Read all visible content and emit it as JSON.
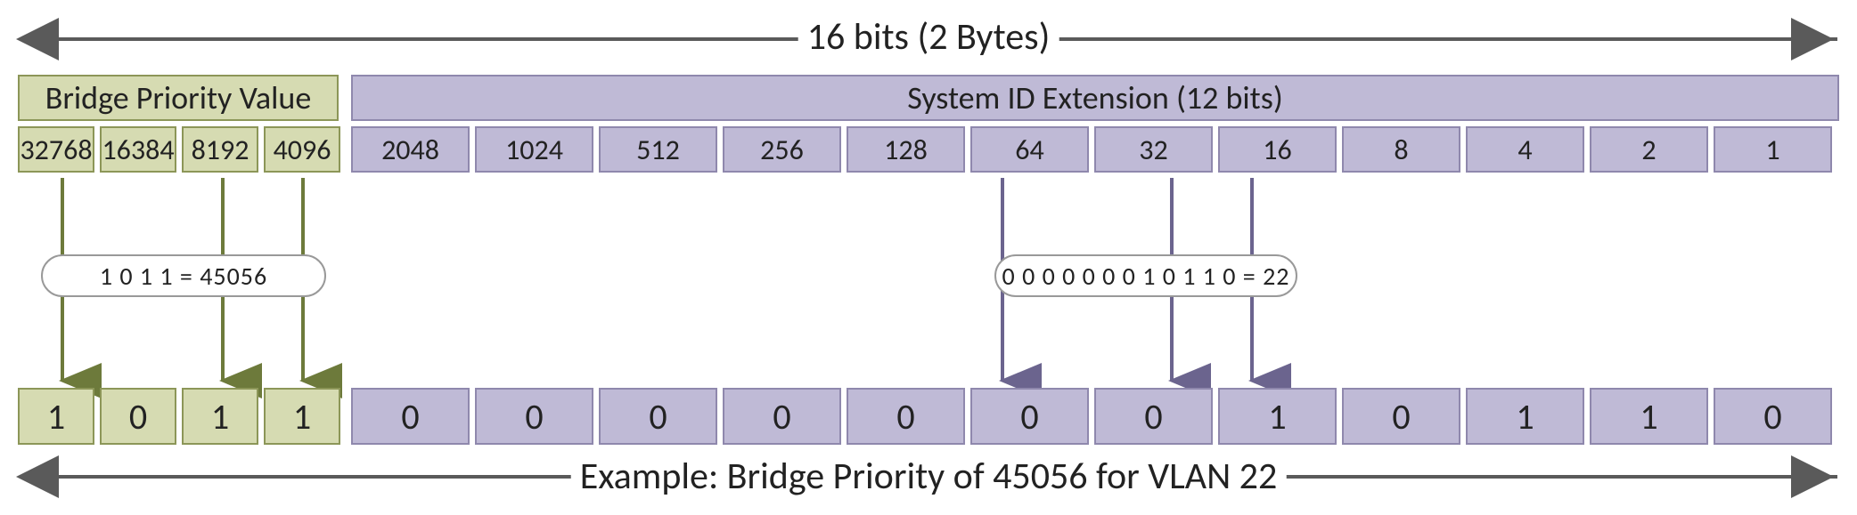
{
  "top_caption": "16 bits (2 Bytes)",
  "bottom_caption": "Example: Bridge Priority of 45056 for VLAN 22",
  "priority": {
    "header": "Bridge Priority Value",
    "values": [
      "32768",
      "16384",
      "8192",
      "4096"
    ],
    "bubble": "1 0 1 1 = 45056",
    "bits": [
      "1",
      "0",
      "1",
      "1"
    ]
  },
  "sysid": {
    "header": "System ID Extension (12 bits)",
    "values": [
      "2048",
      "1024",
      "512",
      "256",
      "128",
      "64",
      "32",
      "16",
      "8",
      "4",
      "2",
      "1"
    ],
    "bubble": "0 0 0 0 0 0 0 1 0 1 1 0 = 22",
    "bits": [
      "0",
      "0",
      "0",
      "0",
      "0",
      "0",
      "0",
      "1",
      "0",
      "1",
      "1",
      "0"
    ]
  }
}
